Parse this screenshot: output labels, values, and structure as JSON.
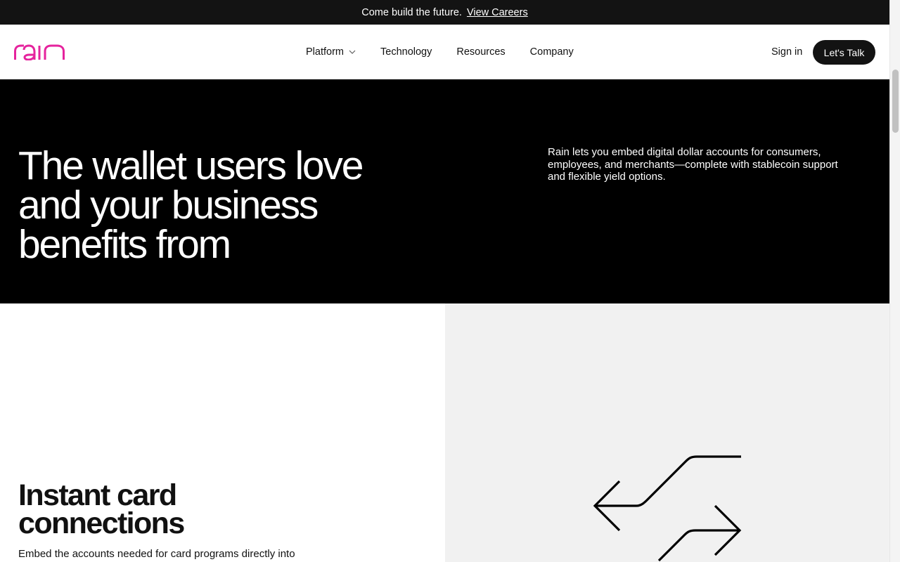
{
  "announcement": {
    "text": "Come build the future.",
    "link_label": "View Careers"
  },
  "header": {
    "logo_alt": "rain",
    "brand_color": "#e5239d",
    "nav": [
      {
        "label": "Platform",
        "has_dropdown": true
      },
      {
        "label": "Technology"
      },
      {
        "label": "Resources"
      },
      {
        "label": "Company"
      }
    ],
    "signin_label": "Sign in",
    "cta_label": "Let's Talk"
  },
  "hero": {
    "title": "The wallet users love and your business benefits from",
    "description": "Rain lets you embed digital dollar accounts for consumers, employees, and merchants—complete with stablecoin support and flexible yield options."
  },
  "feature": {
    "title": "Instant card connections",
    "description": "Embed the accounts needed for card programs directly into",
    "illustration_icon": "exchange-arrows-icon"
  },
  "colors": {
    "announcement_bg": "#131313",
    "hero_bg": "#000000",
    "feature_panel_bg": "#f1f1f1",
    "cta_bg": "#131313"
  }
}
